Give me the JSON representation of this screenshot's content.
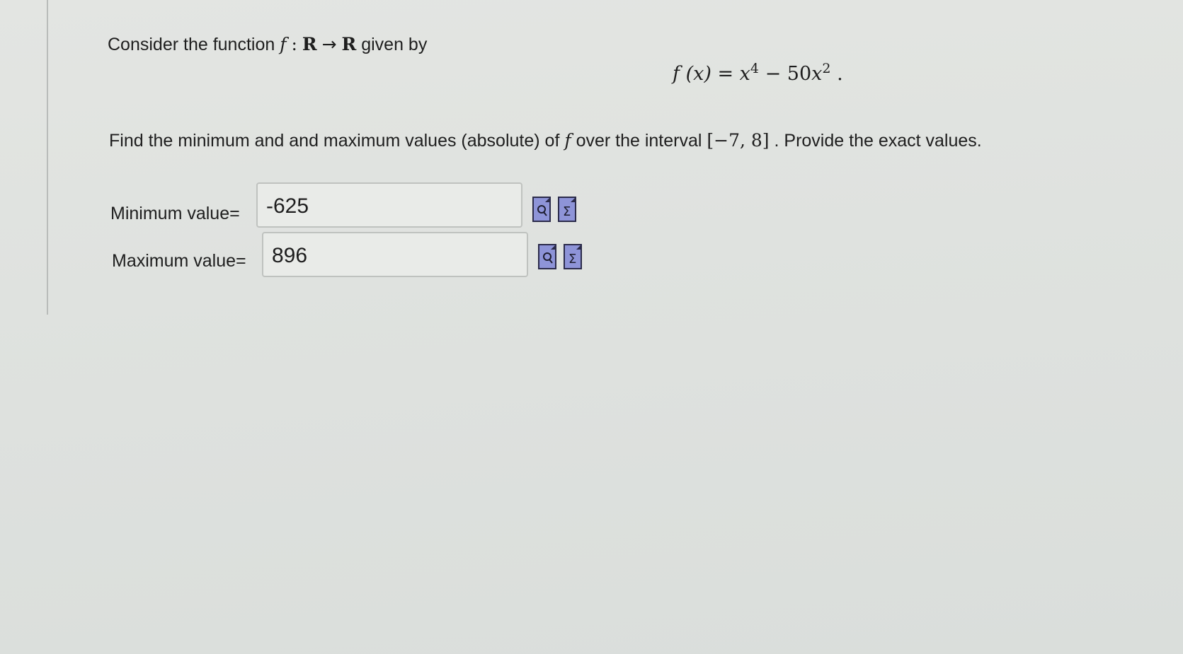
{
  "question": {
    "intro_prefix": "Consider the function",
    "intro_suffix": "given by",
    "func_f": "f",
    "func_colon": ":",
    "set_R": "R",
    "arrow": "→",
    "equation_lhs": "f (x) =",
    "equation_x": "x",
    "equation_exp1": "4",
    "equation_minus": "− 50",
    "equation_exp2": "2",
    "equation_end": ".",
    "find_prefix": "Find the minimum and and maximum values (absolute) of",
    "find_mid": "over the interval",
    "interval": "[−7, 8]",
    "find_suffix": ". Provide the exact values."
  },
  "answers": {
    "min_label": "Minimum value=",
    "min_value": "-625",
    "max_label": "Maximum value=",
    "max_value": "896"
  },
  "icons": {
    "preview": "preview-icon",
    "equation": "equation-editor-icon"
  }
}
